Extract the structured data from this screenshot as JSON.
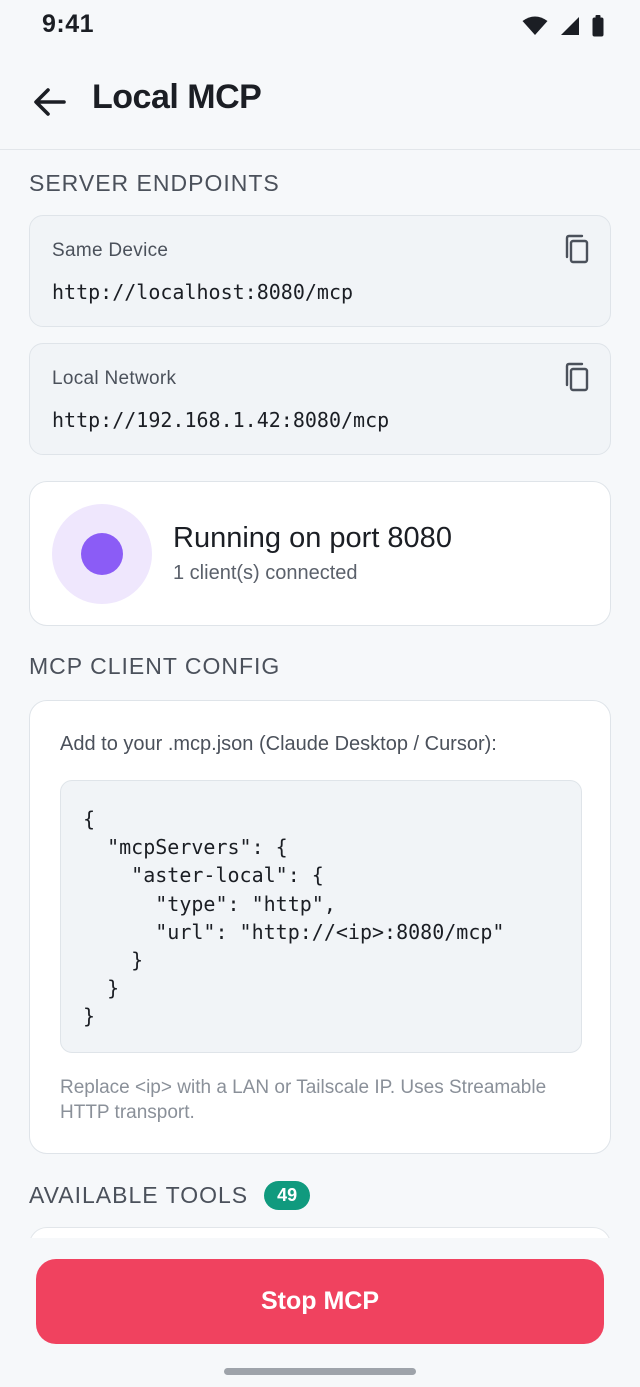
{
  "status_bar": {
    "time": "9:41",
    "icons": [
      "wifi-icon",
      "signal-icon",
      "battery-icon"
    ]
  },
  "app_bar": {
    "back_icon": "arrow-left-icon",
    "title": "Local MCP"
  },
  "endpoints": {
    "section_title": "SERVER ENDPOINTS",
    "items": [
      {
        "label": "Same Device",
        "url": "http://localhost:8080/mcp",
        "icon": "copy-icon"
      },
      {
        "label": "Local Network",
        "url": "http://192.168.1.42:8080/mcp",
        "icon": "copy-icon"
      }
    ]
  },
  "server_status": {
    "title": "Running on port 8080",
    "subtitle": "1 client(s) connected",
    "indicator_color": "#8b5cf6"
  },
  "client_config": {
    "section_title": "MCP CLIENT CONFIG",
    "intro": "Add to your .mcp.json (Claude Desktop / Cursor):",
    "code_lines": [
      "{",
      "  \"mcpServers\": {",
      "    \"aster-local\": {",
      "      \"type\": \"http\",",
      "      \"url\": \"http://<ip>:8080/mcp\"",
      "    }",
      "  }",
      "}"
    ],
    "note": "Replace <ip> with a LAN or Tailscale IP. Uses Streamable HTTP transport."
  },
  "tools": {
    "section_title": "AVAILABLE TOOLS",
    "count": "49",
    "badge_color": "#109a7e"
  },
  "actions": {
    "stop_label": "Stop MCP",
    "stop_color": "#f0425f"
  }
}
